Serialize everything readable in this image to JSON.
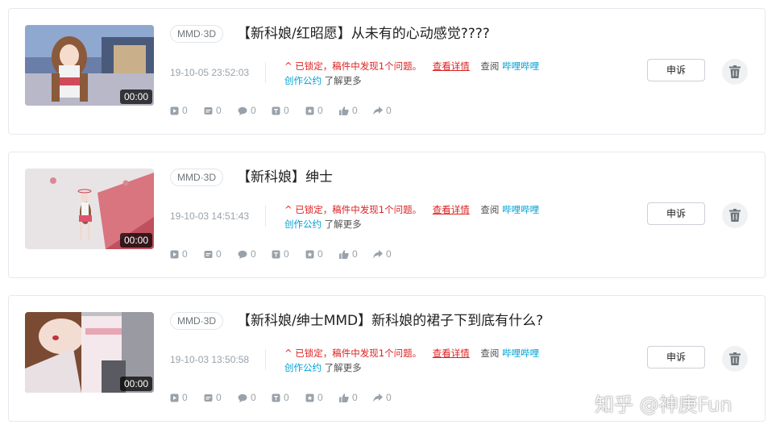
{
  "videos": [
    {
      "tag": "MMD·3D",
      "title": "【新科娘/红昭愿】从未有的心动感觉????",
      "duration": "00:00",
      "timestamp": "19-10-05 23:52:03",
      "stats": {
        "plays": "0",
        "danmaku": "0",
        "comments": "0",
        "coins": "0",
        "favorites": "0",
        "likes": "0",
        "shares": "0"
      }
    },
    {
      "tag": "MMD·3D",
      "title": "【新科娘】绅士",
      "duration": "00:00",
      "timestamp": "19-10-03 14:51:43",
      "stats": {
        "plays": "0",
        "danmaku": "0",
        "comments": "0",
        "coins": "0",
        "favorites": "0",
        "likes": "0",
        "shares": "0"
      }
    },
    {
      "tag": "MMD·3D",
      "title": "【新科娘/绅士MMD】新科娘的裙子下到底有什么?",
      "duration": "00:00",
      "timestamp": "19-10-03 13:50:58",
      "stats": {
        "plays": "0",
        "danmaku": "0",
        "comments": "0",
        "coins": "0",
        "favorites": "0",
        "likes": "0",
        "shares": "0"
      }
    }
  ],
  "notice": {
    "locked_text": "^ 已锁定，稿件中发现1个问题。",
    "detail_link": "查看详情",
    "consult": "查阅",
    "platform_link": "哔哩哔哩",
    "convention_link": "创作公约",
    "learn_more": "了解更多"
  },
  "actions": {
    "appeal_label": "申诉",
    "delete_icon": "trash-icon"
  },
  "watermark": "知乎 @神庚Fun",
  "colors": {
    "warning": "#dd2222",
    "link": "#00a1d6",
    "muted": "#99a2aa"
  }
}
